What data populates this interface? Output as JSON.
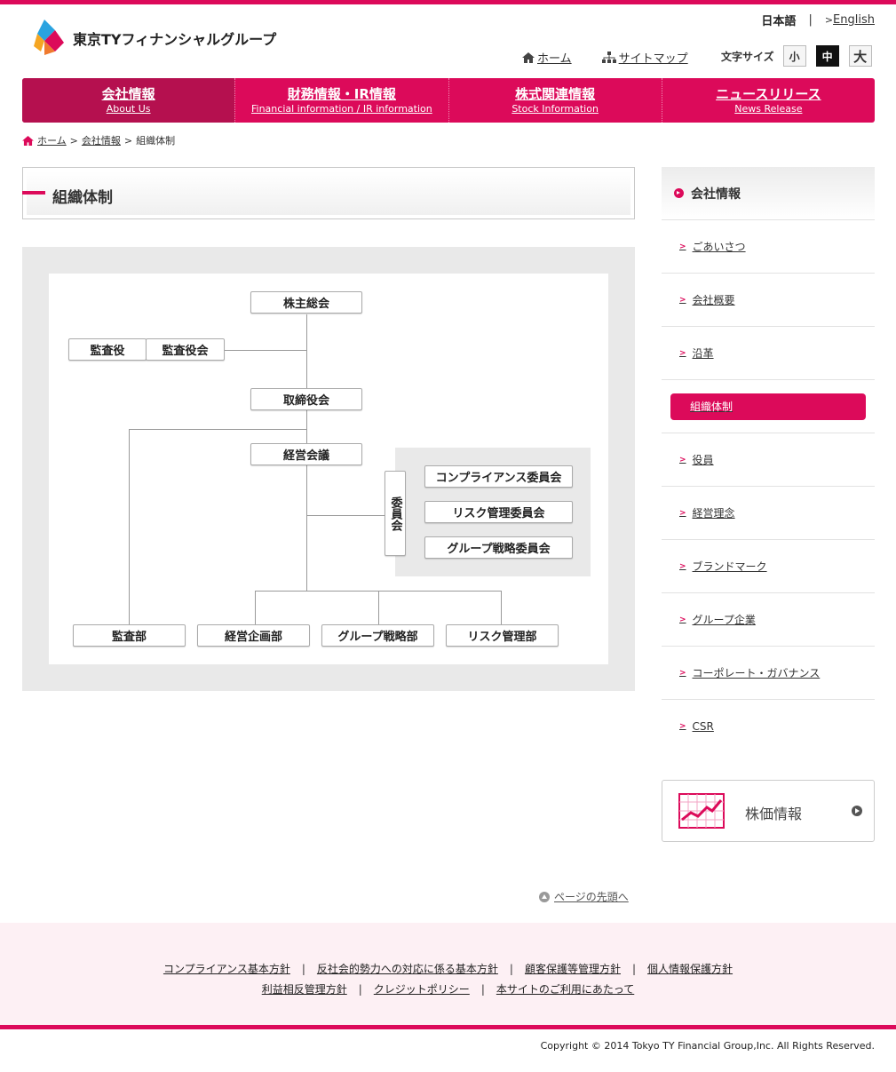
{
  "header": {
    "logo_text": "東京TYフィナンシャルグループ",
    "lang_ja": "日本語",
    "lang_en": "English",
    "home_link": "ホーム",
    "sitemap_link": "サイトマップ",
    "font_size_label": "文字サイズ",
    "font_small": "小",
    "font_medium": "中",
    "font_large": "大"
  },
  "nav": [
    {
      "jp": "会社情報",
      "en": "About Us"
    },
    {
      "jp": "財務情報・IR情報",
      "en": "Financial information / IR information"
    },
    {
      "jp": "株式関連情報",
      "en": "Stock Information"
    },
    {
      "jp": "ニュースリリース",
      "en": "News Release"
    }
  ],
  "breadcrumb": {
    "home": "ホーム",
    "section": "会社情報",
    "current": "組織体制"
  },
  "page_title": "組織体制",
  "org": {
    "shareholders": "株主総会",
    "auditor": "監査役",
    "audit_board": "監査役会",
    "board": "取締役会",
    "mgmt_council": "経営会議",
    "committee": "委員会",
    "compliance_committee": "コンプライアンス委員会",
    "risk_committee": "リスク管理委員会",
    "group_strategy_committee": "グループ戦略委員会",
    "audit_dept": "監査部",
    "planning_dept": "経営企画部",
    "group_strategy_dept": "グループ戦略部",
    "risk_dept": "リスク管理部"
  },
  "sidebar": {
    "heading": "会社情報",
    "items": [
      "ごあいさつ",
      "会社概要",
      "沿革",
      "組織体制",
      "役員",
      "経営理念",
      "ブランドマーク",
      "グループ企業",
      "コーポレート・ガバナンス",
      "CSR"
    ],
    "active_index": 3
  },
  "stock_banner": "株価情報",
  "page_top": "ページの先頭へ",
  "footer": {
    "links_row1": [
      "コンプライアンス基本方針",
      "反社会的勢力への対応に係る基本方針",
      "顧客保護等管理方針",
      "個人情報保護方針"
    ],
    "links_row2": [
      "利益相反管理方針",
      "クレジットポリシー",
      "本サイトのご利用にあたって"
    ],
    "copyright": "Copyright © 2014 Tokyo TY Financial Group,Inc. All Rights Reserved."
  },
  "colors": {
    "brand": "#dc0a5a",
    "brand_dark": "#b5104f",
    "footer_bg": "#fdf0f4"
  }
}
